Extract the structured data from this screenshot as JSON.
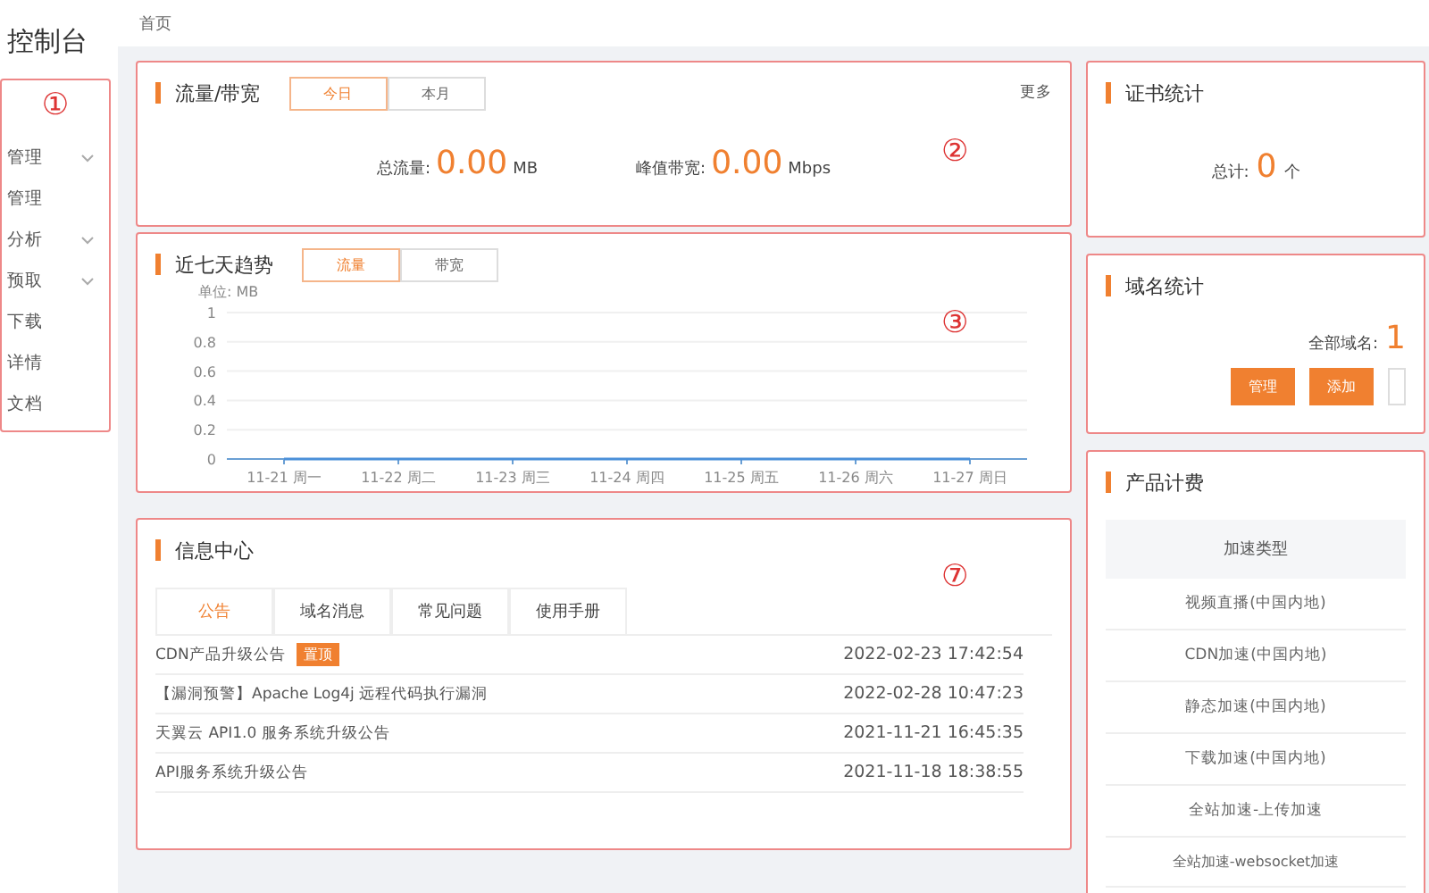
{
  "sidebar": {
    "title": "控制台",
    "marker": "①",
    "items": [
      {
        "label": "管理",
        "expandable": true
      },
      {
        "label": "管理",
        "expandable": false
      },
      {
        "label": "分析",
        "expandable": true
      },
      {
        "label": "预取",
        "expandable": true
      },
      {
        "label": "下载",
        "expandable": false
      },
      {
        "label": "详情",
        "expandable": false
      },
      {
        "label": "文档",
        "expandable": false
      }
    ]
  },
  "breadcrumb": "首页",
  "traffic": {
    "title": "流量/带宽",
    "marker": "②",
    "more": "更多",
    "tabs": [
      {
        "label": "今日",
        "selected": true
      },
      {
        "label": "本月",
        "selected": false
      }
    ],
    "stats": [
      {
        "label": "总流量:",
        "value": "0.00",
        "unit": "MB"
      },
      {
        "label": "峰值带宽:",
        "value": "0.00",
        "unit": "Mbps"
      }
    ]
  },
  "trend": {
    "title": "近七天趋势",
    "marker": "③",
    "tabs": [
      {
        "label": "流量",
        "selected": true
      },
      {
        "label": "带宽",
        "selected": false
      }
    ],
    "chart_data": {
      "type": "line",
      "ylabel": "单位: MB",
      "categories": [
        "11-21 周一",
        "11-22 周二",
        "11-23 周三",
        "11-24 周四",
        "11-25 周五",
        "11-26 周六",
        "11-27 周日"
      ],
      "grid": true,
      "series": [
        {
          "color": "#4a90d9",
          "values": [
            0,
            0,
            0,
            0,
            0,
            0,
            0
          ]
        }
      ],
      "ylim": [
        0,
        1
      ],
      "yticks": [
        0,
        0.2,
        0.4,
        0.6,
        0.8,
        1
      ]
    }
  },
  "info": {
    "title": "信息中心",
    "marker": "⑦",
    "tabs": [
      {
        "label": "公告",
        "selected": true
      },
      {
        "label": "域名消息",
        "selected": false
      },
      {
        "label": "常见问题",
        "selected": false
      },
      {
        "label": "使用手册",
        "selected": false
      }
    ],
    "rows": [
      {
        "title": "CDN产品升级公告",
        "badge": "置顶",
        "time": "2022-02-23 17:42:54"
      },
      {
        "title": "【漏洞预警】Apache Log4j 远程代码执行漏洞",
        "time": "2022-02-28 10:47:23"
      },
      {
        "title": "天翼云 API1.0 服务系统升级公告",
        "time": "2021-11-21 16:45:35"
      },
      {
        "title": "API服务系统升级公告",
        "time": "2021-11-18 18:38:55"
      }
    ]
  },
  "certs": {
    "title": "证书统计",
    "label": "总计:",
    "value": "0",
    "unit": "个"
  },
  "domains": {
    "title": "域名统计",
    "label": "全部域名:",
    "value": "1",
    "buttons": [
      "管理",
      "添加"
    ]
  },
  "pricing": {
    "title": "产品计费",
    "column": "加速类型",
    "rows": [
      "视频直播(中国内地)",
      "CDN加速(中国内地)",
      "静态加速(中国内地)",
      "下载加速(中国内地)",
      "全站加速-上传加速",
      "全站加速-websocket加速"
    ]
  }
}
